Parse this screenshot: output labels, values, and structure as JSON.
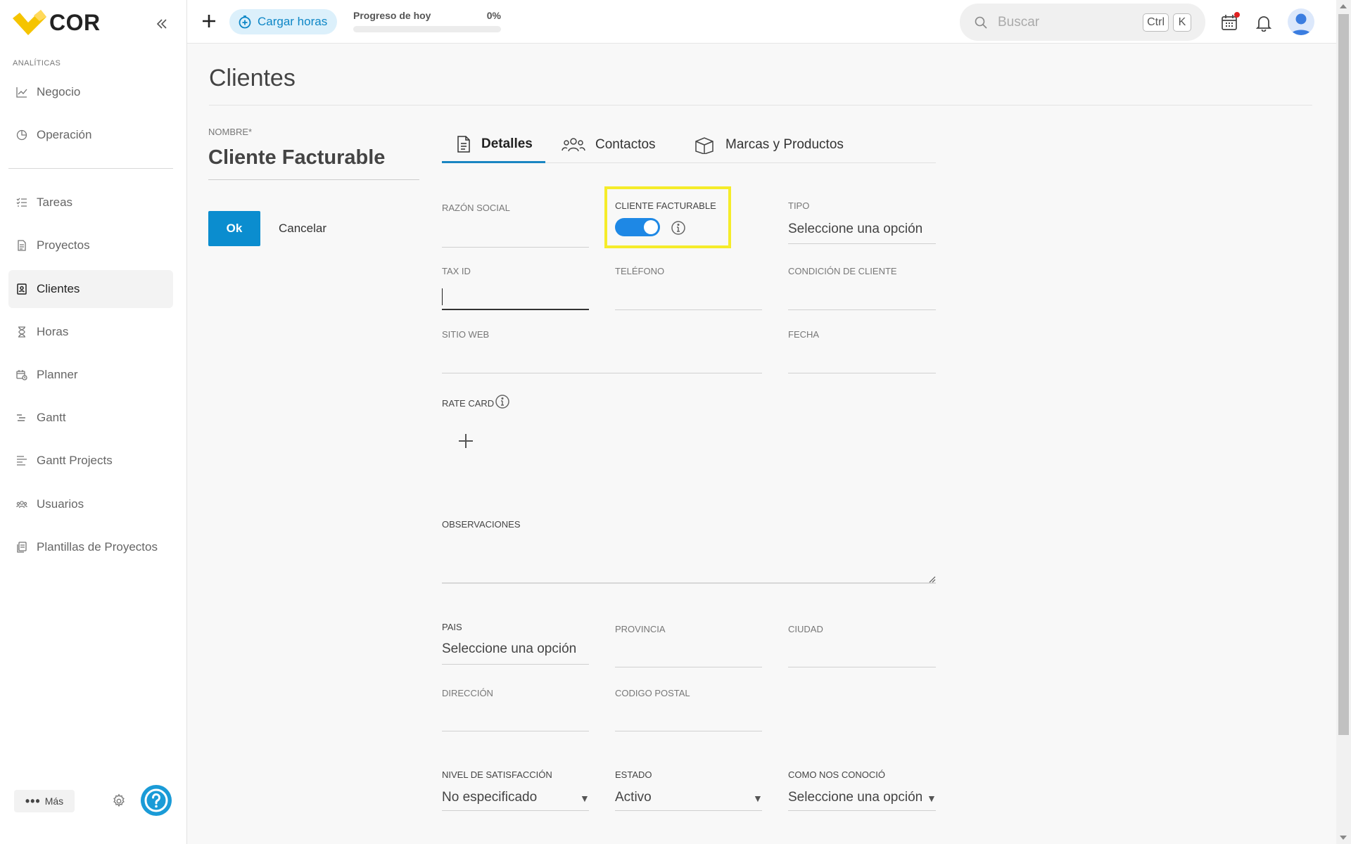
{
  "app": {
    "brand": "COR"
  },
  "sidebar": {
    "section_label": "ANALÍTICAS",
    "items": [
      {
        "label": "Negocio",
        "icon": "line-chart-icon"
      },
      {
        "label": "Operación",
        "icon": "pie-chart-icon"
      },
      {
        "label": "Tareas",
        "icon": "task-list-icon"
      },
      {
        "label": "Proyectos",
        "icon": "document-icon"
      },
      {
        "label": "Clientes",
        "icon": "contact-book-icon",
        "active": true
      },
      {
        "label": "Horas",
        "icon": "hourglass-icon"
      },
      {
        "label": "Planner",
        "icon": "calendar-clock-icon"
      },
      {
        "label": "Gantt",
        "icon": "gantt-icon"
      },
      {
        "label": "Gantt Projects",
        "icon": "gantt-lines-icon"
      },
      {
        "label": "Usuarios",
        "icon": "users-icon"
      },
      {
        "label": "Plantillas de Proyectos",
        "icon": "templates-icon"
      }
    ],
    "more_label": "Más"
  },
  "topbar": {
    "load_hours_label": "Cargar horas",
    "progress_label": "Progreso de hoy",
    "progress_value": "0%",
    "progress_fraction": 0,
    "search_placeholder": "Buscar",
    "shortcut_keys": [
      "Ctrl",
      "K"
    ]
  },
  "page": {
    "title": "Clientes",
    "name_label": "NOMBRE*",
    "name_value": "Cliente Facturable",
    "ok_label": "Ok",
    "cancel_label": "Cancelar"
  },
  "tabs": [
    {
      "label": "Detalles",
      "icon": "document-icon",
      "active": true
    },
    {
      "label": "Contactos",
      "icon": "users-icon"
    },
    {
      "label": "Marcas y Productos",
      "icon": "box-icon"
    }
  ],
  "form": {
    "razon_social": {
      "label": "RAZÓN SOCIAL",
      "value": ""
    },
    "cliente_facturable": {
      "label": "CLIENTE FACTURABLE",
      "value": true
    },
    "tipo": {
      "label": "TIPO",
      "value": "Seleccione una opción"
    },
    "tax_id": {
      "label": "TAX ID",
      "value": ""
    },
    "telefono": {
      "label": "TELÉFONO",
      "value": ""
    },
    "condicion_cliente": {
      "label": "CONDICIÓN DE CLIENTE",
      "value": ""
    },
    "sitio_web": {
      "label": "SITIO WEB",
      "value": ""
    },
    "fecha": {
      "label": "FECHA",
      "value": ""
    },
    "rate_card": {
      "label": "RATE CARD"
    },
    "observaciones": {
      "label": "OBSERVACIONES",
      "value": ""
    },
    "pais": {
      "label": "PAIS",
      "value": "Seleccione una opción"
    },
    "provincia": {
      "label": "PROVINCIA",
      "value": ""
    },
    "ciudad": {
      "label": "CIUDAD",
      "value": ""
    },
    "direccion": {
      "label": "DIRECCIÓN",
      "value": ""
    },
    "codigo_postal": {
      "label": "CODIGO POSTAL",
      "value": ""
    },
    "nivel_satisfaccion": {
      "label": "NIVEL DE SATISFACCIÓN",
      "value": "No especificado"
    },
    "estado": {
      "label": "ESTADO",
      "value": "Activo"
    },
    "como_nos_conocio": {
      "label": "COMO NOS CONOCIÓ",
      "value": "Seleccione una opción"
    }
  },
  "colors": {
    "accent": "#0b8dcf",
    "toggle_on": "#1e88e5",
    "highlight": "#f5ec2a",
    "logo_yellow": "#f5c400"
  }
}
